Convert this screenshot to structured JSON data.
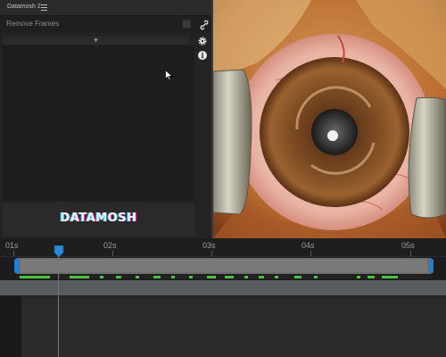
{
  "panel": {
    "title": "Datamosh 2",
    "menu_icon": "hamburger-menu-icon",
    "remove_frames_label": "Remove Frames",
    "add_symbol": "+",
    "logo_text": "DATAMOSH",
    "icons": [
      "checkbox-icon",
      "link-icon",
      "gear-icon",
      "info-icon",
      "mouse-cursor-icon"
    ]
  },
  "timeline": {
    "tick_labels": [
      "01s",
      "02s",
      "03s",
      "04s",
      "05s"
    ],
    "playhead_icon": "playhead-marker-icon"
  },
  "colors": {
    "accent_blue": "#1e7fd6",
    "keyframe_green": "#4bc23f",
    "panel_bg": "#232323"
  }
}
